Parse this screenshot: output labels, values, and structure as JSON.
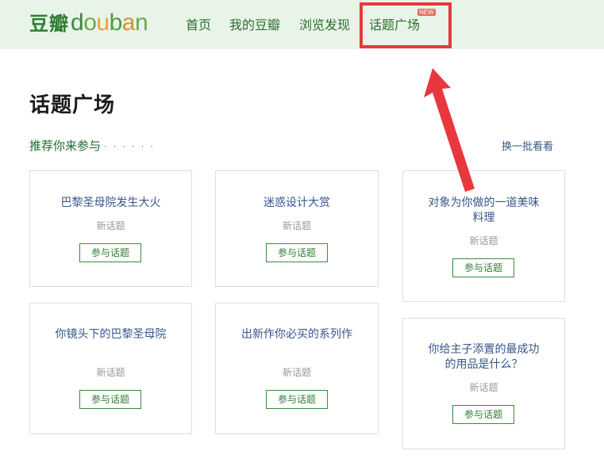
{
  "logo": {
    "cn": "豆瓣",
    "en": [
      "d",
      "o",
      "u",
      "b",
      "a",
      "n"
    ]
  },
  "nav": {
    "items": [
      {
        "label": "首页"
      },
      {
        "label": "我的豆瓣"
      },
      {
        "label": "浏览发现"
      },
      {
        "label": "话题广场"
      }
    ],
    "badge": "NEW"
  },
  "page": {
    "title": "话题广场",
    "section_title": "推荐你来参与",
    "section_dots": "· · · · · ·",
    "refresh": "换一批看看"
  },
  "topics": [
    {
      "title": "巴黎圣母院发生大火",
      "sub": "新话题",
      "button": "参与话题"
    },
    {
      "title": "迷惑设计大赏",
      "sub": "新话题",
      "button": "参与话题"
    },
    {
      "title": "对象为你做的一道美味料理",
      "sub": "新话题",
      "button": "参与话题"
    },
    {
      "title": "你镜头下的巴黎圣母院",
      "sub": "新话题",
      "button": "参与话题"
    },
    {
      "title": "出新作你必买的系列作",
      "sub": "新话题",
      "button": "参与话题"
    },
    {
      "title": "你给主子添置的最成功的用品是什么？",
      "sub": "新话题",
      "button": "参与话题"
    }
  ],
  "colors": {
    "highlight": "#e8383d",
    "brand_green": "#2f7d32",
    "link_blue": "#37558a"
  }
}
